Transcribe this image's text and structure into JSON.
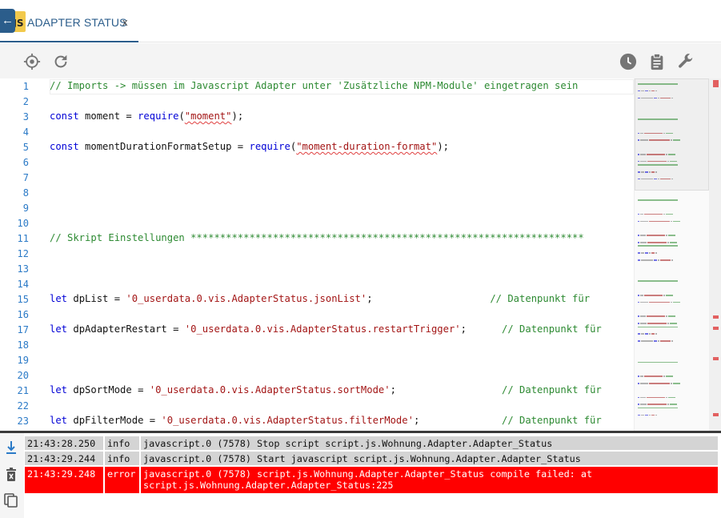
{
  "tab": {
    "title": "ADAPTER STATUS",
    "close_glyph": "x",
    "back_icon": "arrow-left-icon",
    "file_icon_label": "JS"
  },
  "toolbar": {
    "left_icons": [
      "target-icon",
      "refresh-icon"
    ],
    "right_icons": [
      "clock-icon",
      "clipboard-icon",
      "wrench-icon"
    ]
  },
  "editor": {
    "lines": [
      {
        "n": "1",
        "parts": [
          {
            "t": "// Imports -> müssen im Javascript Adapter unter 'Zusätzliche NPM-Module' eingetragen sein",
            "c": "cmt"
          }
        ]
      },
      {
        "n": "2",
        "parts": []
      },
      {
        "n": "3",
        "parts": [
          {
            "t": "const",
            "c": "kw"
          },
          {
            "t": " moment = ",
            "c": ""
          },
          {
            "t": "require",
            "c": "kw"
          },
          {
            "t": "(",
            "c": ""
          },
          {
            "t": "\"moment\"",
            "c": "str squig"
          },
          {
            "t": ");",
            "c": ""
          }
        ]
      },
      {
        "n": "4",
        "parts": []
      },
      {
        "n": "5",
        "parts": [
          {
            "t": "const",
            "c": "kw"
          },
          {
            "t": " momentDurationFormatSetup = ",
            "c": ""
          },
          {
            "t": "require",
            "c": "kw"
          },
          {
            "t": "(",
            "c": ""
          },
          {
            "t": "\"moment-duration-format\"",
            "c": "str squig"
          },
          {
            "t": ");",
            "c": ""
          }
        ]
      },
      {
        "n": "6",
        "parts": []
      },
      {
        "n": "7",
        "parts": []
      },
      {
        "n": "8",
        "parts": []
      },
      {
        "n": "9",
        "parts": []
      },
      {
        "n": "10",
        "parts": []
      },
      {
        "n": "11",
        "parts": [
          {
            "t": "// Skript Einstellungen *******************************************************************",
            "c": "cmt"
          }
        ]
      },
      {
        "n": "12",
        "parts": []
      },
      {
        "n": "13",
        "parts": []
      },
      {
        "n": "14",
        "parts": []
      },
      {
        "n": "15",
        "parts": [
          {
            "t": "let",
            "c": "kw"
          },
          {
            "t": " dpList = ",
            "c": ""
          },
          {
            "t": "'0_userdata.0.vis.AdapterStatus.jsonList'",
            "c": "str"
          },
          {
            "t": ";                    ",
            "c": ""
          },
          {
            "t": "// Datenpunkt für",
            "c": "cmt"
          }
        ]
      },
      {
        "n": "16",
        "parts": []
      },
      {
        "n": "17",
        "parts": [
          {
            "t": "let",
            "c": "kw"
          },
          {
            "t": " dpAdapterRestart = ",
            "c": ""
          },
          {
            "t": "'0_userdata.0.vis.AdapterStatus.restartTrigger'",
            "c": "str"
          },
          {
            "t": ";      ",
            "c": ""
          },
          {
            "t": "// Datenpunkt für",
            "c": "cmt"
          }
        ]
      },
      {
        "n": "18",
        "parts": []
      },
      {
        "n": "19",
        "parts": []
      },
      {
        "n": "20",
        "parts": []
      },
      {
        "n": "21",
        "parts": [
          {
            "t": "let",
            "c": "kw"
          },
          {
            "t": " dpSortMode = ",
            "c": ""
          },
          {
            "t": "'0_userdata.0.vis.AdapterStatus.sortMode'",
            "c": "str"
          },
          {
            "t": ";                  ",
            "c": ""
          },
          {
            "t": "// Datenpunkt für",
            "c": "cmt"
          }
        ]
      },
      {
        "n": "22",
        "parts": []
      },
      {
        "n": "23",
        "parts": [
          {
            "t": "let",
            "c": "kw"
          },
          {
            "t": " dpFilterMode = ",
            "c": ""
          },
          {
            "t": "'0_userdata.0.vis.AdapterStatus.filterMode'",
            "c": "str"
          },
          {
            "t": ";              ",
            "c": ""
          },
          {
            "t": "// Datenpunkt für",
            "c": "cmt"
          }
        ]
      }
    ]
  },
  "log": {
    "side_icons": [
      "scroll-to-bottom-icon",
      "clear-log-icon",
      "copy-icon"
    ],
    "rows": [
      {
        "time": "21:43:28.250",
        "severity": "info",
        "message": "javascript.0 (7578) Stop script script.js.Wohnung.Adapter.Adapter_Status"
      },
      {
        "time": "21:43:29.244",
        "severity": "info",
        "message": "javascript.0 (7578) Start javascript script.js.Wohnung.Adapter.Adapter_Status"
      },
      {
        "time": "21:43:29.248",
        "severity": "error",
        "message": "javascript.0 (7578) script.js.Wohnung.Adapter.Adapter_Status compile failed: at\nscript.js.Wohnung.Adapter.Adapter_Status:225"
      }
    ]
  },
  "colors": {
    "accent": "#2b5d8b",
    "line_number": "#2b7ac7",
    "comment": "#2d8a32",
    "keyword": "#0000d6",
    "string": "#a31515",
    "error_row": "#ff0000",
    "log_row": "#d4d4d4"
  }
}
